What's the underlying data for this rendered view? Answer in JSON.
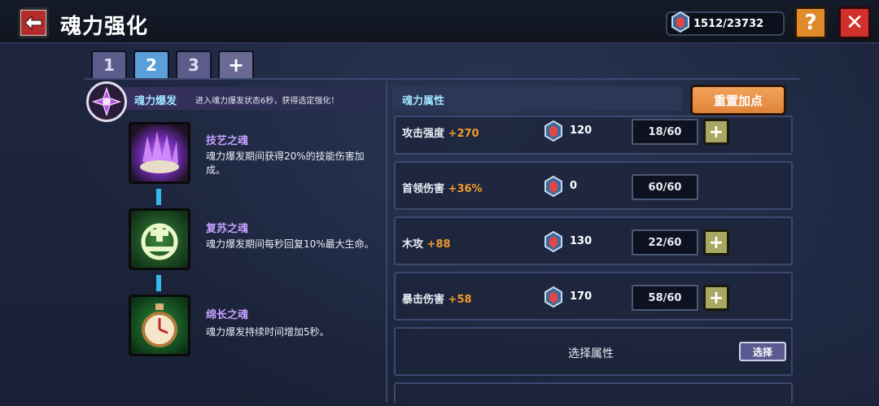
{
  "header": {
    "title": "魂力强化",
    "currency_value": "1512/23732",
    "help_label": "?",
    "close_label": "✕"
  },
  "tabs": [
    {
      "label": "1",
      "active": false
    },
    {
      "label": "2",
      "active": true
    },
    {
      "label": "3",
      "active": false
    },
    {
      "label": "+",
      "active": false
    }
  ],
  "burst": {
    "title": "魂力爆发",
    "description": "进入魂力爆发状态6秒，获得选定强化！"
  },
  "skills": [
    {
      "name": "技艺之魂",
      "description": "魂力爆发期间获得20%的技能伤害加成。",
      "icon": "purple-crystal-icon"
    },
    {
      "name": "复苏之魂",
      "description": "魂力爆发期间每秒回复10%最大生命。",
      "icon": "green-heal-icon"
    },
    {
      "name": "绵长之魂",
      "description": "魂力爆发持续时间增加5秒。",
      "icon": "stopwatch-icon"
    }
  ],
  "attributes": {
    "header": "魂力属性",
    "reset_label": "重置加点",
    "rows": [
      {
        "name": "攻击强度",
        "bonus": "+270",
        "cost": "120",
        "count": "18/60",
        "has_plus": true
      },
      {
        "name": "首领伤害",
        "bonus": "+36%",
        "cost": "0",
        "count": "60/60",
        "has_plus": false
      },
      {
        "name": "木攻",
        "bonus": "+88",
        "cost": "130",
        "count": "22/60",
        "has_plus": true
      },
      {
        "name": "暴击伤害",
        "bonus": "+58",
        "cost": "170",
        "count": "58/60",
        "has_plus": true
      }
    ],
    "select_row_label": "选择属性",
    "select_button_label": "选择"
  },
  "colors": {
    "accent_orange": "#f29a2c",
    "title_cyan": "#9fe4ff",
    "skill_purple": "#c4a0ff",
    "active_tab": "#5aa0d8",
    "close_red": "#d2302c"
  }
}
